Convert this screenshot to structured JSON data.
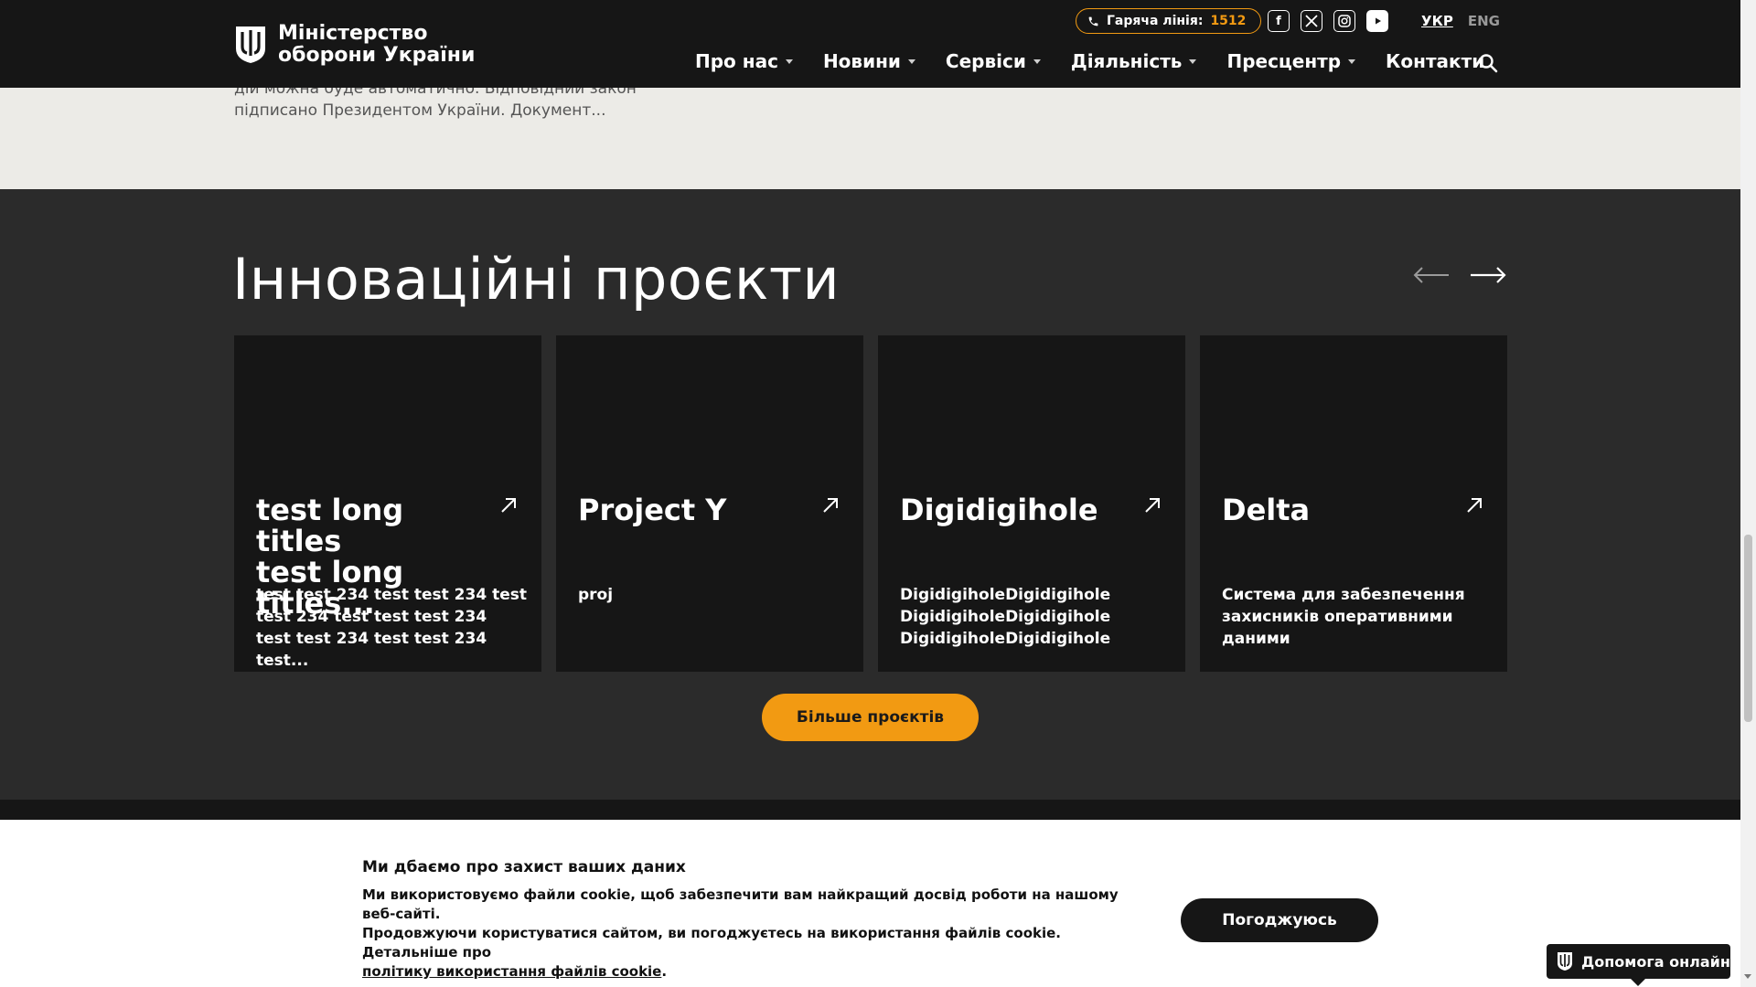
{
  "header": {
    "logo_line1": "Міністерство",
    "logo_line2": "оборони України",
    "hotline_label": "Гаряча лінія:",
    "hotline_number": "1512",
    "socials": [
      "facebook-icon",
      "x-icon",
      "instagram-icon",
      "youtube-icon"
    ],
    "lang_active": "УКР",
    "lang_other": "ENG",
    "nav": [
      "Про нас",
      "Новини",
      "Сервіси",
      "Діяльність",
      "Пресцентр",
      "Контакти"
    ]
  },
  "news": {
    "line1": "дій можна буде автоматично. Відповідний закон",
    "line2": "підписано Президентом України. Документ..."
  },
  "projects": {
    "title": "Інноваційні проєкти",
    "cards": [
      {
        "title_l1": "test long titles",
        "title_l2": "test long titles...",
        "desc_l1": "test test 234 test test 234 test",
        "desc_l2": "test 234 test test test 234",
        "desc_l3": "test test 234 test test 234 test..."
      },
      {
        "title_l1": "Project Y",
        "title_l2": "",
        "desc_l1": "proj",
        "desc_l2": "",
        "desc_l3": ""
      },
      {
        "title_l1": "Digidigihole",
        "title_l2": "",
        "desc_l1": "DigidigiholeDigidigihole",
        "desc_l2": "DigidigiholeDigidigihole",
        "desc_l3": "DigidigiholeDigidigihole"
      },
      {
        "title_l1": "Delta",
        "title_l2": "",
        "desc_l1": "Система для забезпечення",
        "desc_l2": "захисників оперативними",
        "desc_l3": "даними"
      }
    ],
    "more_label": "Більше проєктів"
  },
  "cookie": {
    "title": "Ми дбаємо про захист ваших даних",
    "text_l1": "Ми використовуємо файли cookie, щоб забезпечити вам найкращий досвід роботи на нашому веб-сайті.",
    "text_l2": "Продовжуючи користуватися сайтом, ви погоджуєтесь на використання файлів cookie. Детальніше про",
    "link": "політику використання файлів cookie",
    "agree_label": "Погоджуюсь"
  },
  "help": {
    "label": "Допомога онлайн"
  },
  "colors": {
    "accent": "#f29a12",
    "header_bg": "#161616",
    "section_bg": "#2b2b2b",
    "news_bg": "#ecebe7"
  }
}
